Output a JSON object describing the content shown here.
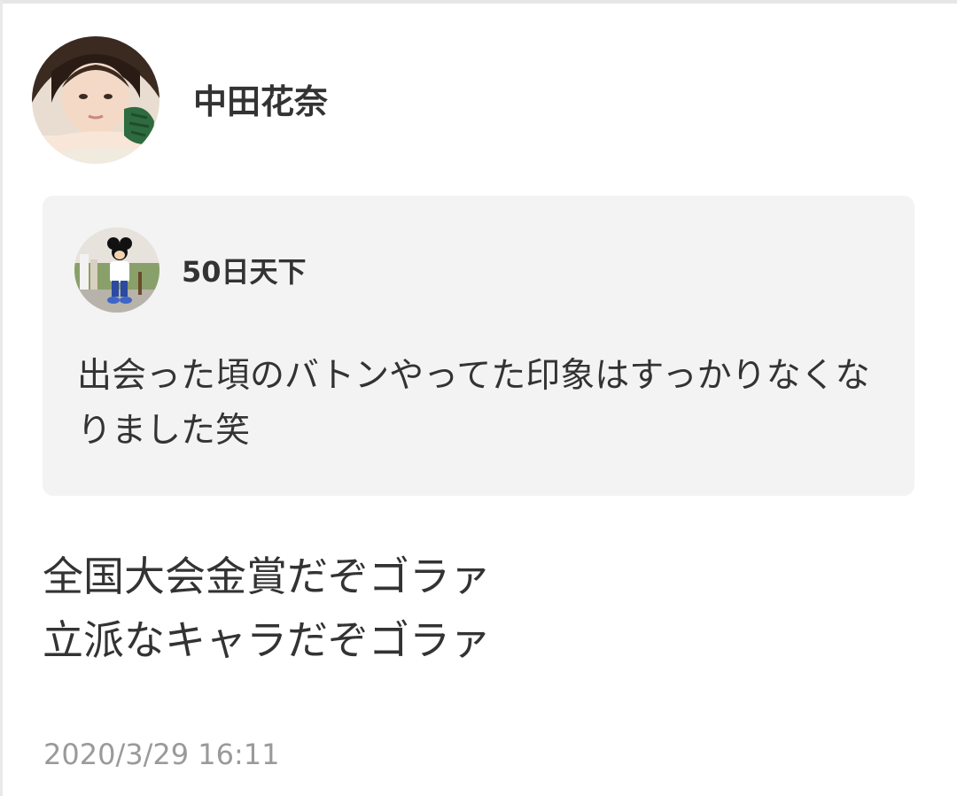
{
  "post": {
    "author": {
      "name": "中田花奈",
      "avatar_icon": "user-avatar-photo"
    },
    "quoted_post": {
      "author_name": "50日天下",
      "avatar_icon": "mascot-avatar-photo",
      "text": "出会った頃のバトンやってた印象はすっかりなくなりました笑"
    },
    "body_lines": [
      "全国大会金賞だぞゴラァ",
      "立派なキャラだぞゴラァ"
    ],
    "timestamp": "2020/3/29 16:11"
  },
  "colors": {
    "background": "#ffffff",
    "quote_background": "#f3f3f3",
    "text": "#333333",
    "timestamp": "#9a9a9a"
  }
}
